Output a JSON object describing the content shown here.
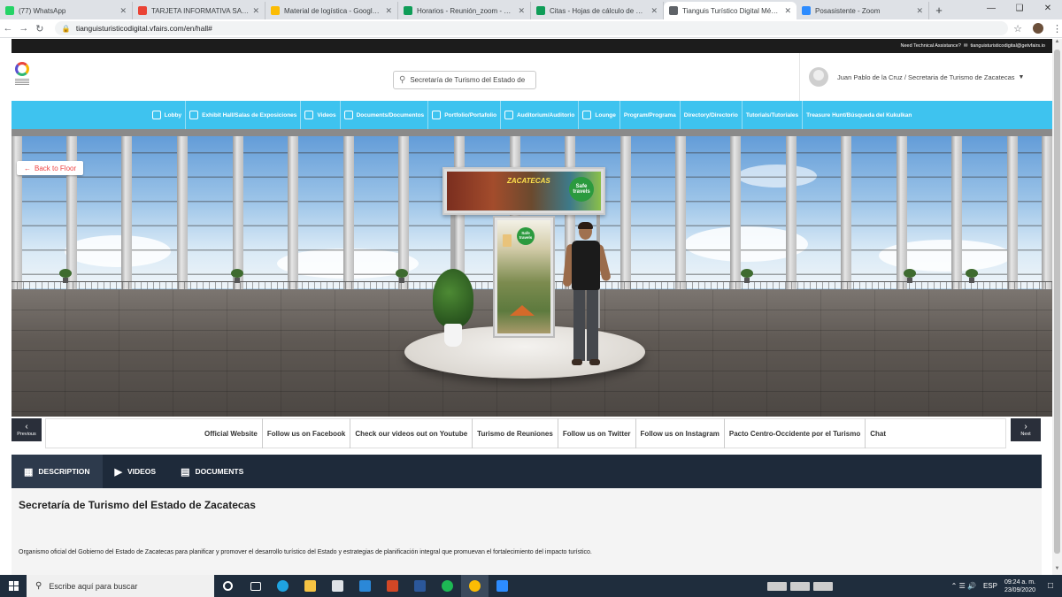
{
  "browser": {
    "tabs": [
      {
        "title": "(77) WhatsApp",
        "color": "#25d366",
        "active": false
      },
      {
        "title": "TARJETA INFORMATIVA SANDRA",
        "color": "#ea4335",
        "active": false
      },
      {
        "title": "Material de logística - Google Dr",
        "color": "#fbbc04",
        "active": false
      },
      {
        "title": "Horarios - Reunión_zoom - Hoja",
        "color": "#0f9d58",
        "active": false
      },
      {
        "title": "Citas - Hojas de cálculo de Goog",
        "color": "#0f9d58",
        "active": false
      },
      {
        "title": "Tianguis Turístico Digital México",
        "color": "#5f6368",
        "active": true
      },
      {
        "title": "Posasistente - Zoom",
        "color": "#2d8cff",
        "active": false
      }
    ],
    "new_tab": "+",
    "url": "tianguisturisticodigital.vfairs.com/en/hall#"
  },
  "site": {
    "assistance": "Need Technical Assistance?",
    "assistance_email": "tianguisturisticodigital@getvfairs.io",
    "search_value": "Secretaría de Turismo del Estado de",
    "user_name": "Juan Pablo de la Cruz / Secretaria de Turismo de Zacatecas",
    "menu": [
      {
        "label": "Lobby",
        "icon": true
      },
      {
        "label": "Exhibit Hall/Salas de Exposiciones",
        "icon": true
      },
      {
        "label": "Videos",
        "icon": true
      },
      {
        "label": "Documents/Documentos",
        "icon": true
      },
      {
        "label": "Portfolio/Portafolio",
        "icon": true
      },
      {
        "label": "Auditorium/Auditorio",
        "icon": true
      },
      {
        "label": "Lounge",
        "icon": true
      },
      {
        "label": "Program/Programa",
        "icon": false
      },
      {
        "label": "Directory/Directorio",
        "icon": false
      },
      {
        "label": "Tutorials/Tutoriales",
        "icon": false
      },
      {
        "label": "Treasure Hunt/Búsqueda del Kukulkan",
        "icon": false
      }
    ],
    "back_to_floor": "Back to Floor",
    "booth": {
      "banner_brand": "ZACATECAS",
      "badge": "Safe travels"
    }
  },
  "links_bar": {
    "previous": "Previous",
    "next": "Next",
    "links": [
      "Official Website",
      "Follow us on Facebook",
      "Check our videos out on Youtube",
      "Turismo de Reuniones",
      "Follow us on Twitter",
      "Follow us on Instagram",
      "Pacto Centro-Occidente por el Turismo",
      "Chat"
    ]
  },
  "description": {
    "tabs": [
      {
        "label": "DESCRIPTION",
        "icon": "building-icon"
      },
      {
        "label": "VIDEOS",
        "icon": "play-icon"
      },
      {
        "label": "DOCUMENTS",
        "icon": "document-icon"
      }
    ],
    "title": "Secretaría de Turismo del Estado de Zacatecas",
    "text": "Organismo oficial del Gobierno del Estado de Zacatecas para planificar y promover el desarrollo turístico del Estado y estrategias de planificación integral que promuevan el fortalecimiento del impacto turístico."
  },
  "taskbar": {
    "search_placeholder": "Escribe aquí para buscar",
    "lang": "ESP",
    "time": "09:24 a. m.",
    "date": "23/09/2020",
    "apps": [
      {
        "name": "cortana-icon",
        "color": "#ffffff"
      },
      {
        "name": "task-view-icon",
        "color": "#ffffff"
      },
      {
        "name": "edge-icon",
        "color": "#1fa3e0"
      },
      {
        "name": "file-explorer-icon",
        "color": "#f6c343"
      },
      {
        "name": "store-icon",
        "color": "#dfe3e8"
      },
      {
        "name": "mail-icon",
        "color": "#2b88d8"
      },
      {
        "name": "powerpoint-icon",
        "color": "#d24726"
      },
      {
        "name": "word-icon",
        "color": "#2b579a"
      },
      {
        "name": "spotify-icon",
        "color": "#1db954"
      },
      {
        "name": "chrome-icon",
        "color": "#fbbc04"
      },
      {
        "name": "zoom-icon",
        "color": "#2d8cff"
      }
    ]
  },
  "colors": {
    "menu_bar": "#3ec3ef",
    "dark_nav": "#1e2a3a",
    "back_button_text": "#e44444"
  }
}
